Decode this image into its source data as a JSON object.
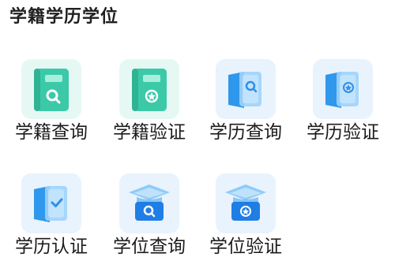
{
  "section": {
    "title": "学籍学历学位"
  },
  "items": [
    {
      "label": "学籍查询",
      "icon": "green-book-search-icon"
    },
    {
      "label": "学籍验证",
      "icon": "green-book-verify-icon"
    },
    {
      "label": "学历查询",
      "icon": "blue-folder-search-icon"
    },
    {
      "label": "学历验证",
      "icon": "blue-folder-verify-icon"
    },
    {
      "label": "学历认证",
      "icon": "blue-folder-check-icon"
    },
    {
      "label": "学位查询",
      "icon": "grad-cap-search-icon"
    },
    {
      "label": "学位验证",
      "icon": "grad-cap-verify-icon"
    }
  ],
  "colors": {
    "green_tile_bg": "#e6f8f4",
    "blue_tile_bg": "#e9f3fd",
    "green_icon": "#3cc9a8",
    "blue_icon": "#3aa3ee",
    "dark_blue_icon": "#1f7ee6"
  }
}
